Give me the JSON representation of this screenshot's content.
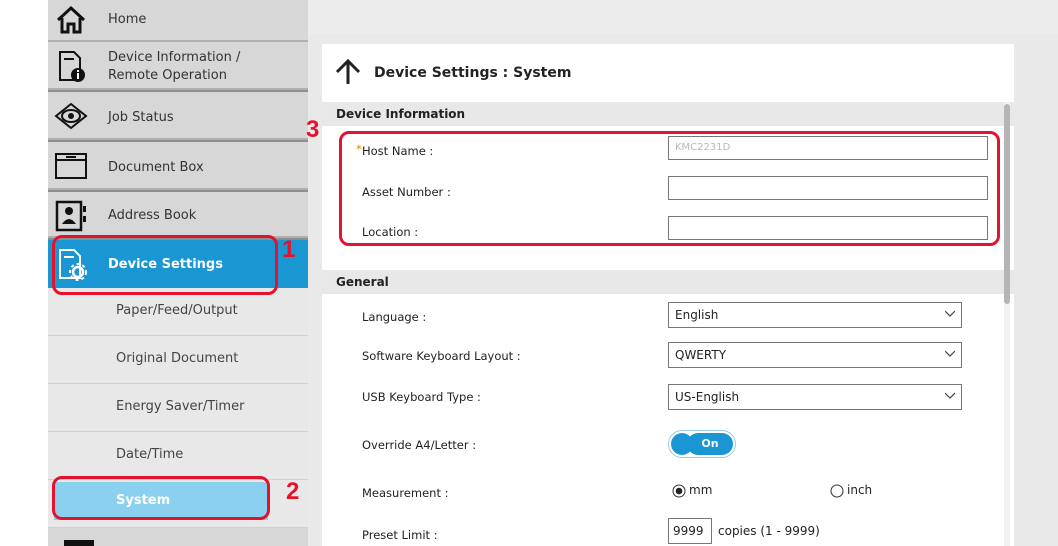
{
  "sidebar": {
    "items": [
      {
        "label": "Home",
        "icon": "home-icon"
      },
      {
        "label": "Device Information /",
        "label2": "Remote Operation",
        "icon": "device-info-icon"
      },
      {
        "label": "Job Status",
        "icon": "eye-icon"
      },
      {
        "label": "Document Box",
        "icon": "folder-icon"
      },
      {
        "label": "Address Book",
        "icon": "address-book-icon"
      },
      {
        "label": "Device Settings",
        "icon": "device-settings-icon"
      }
    ],
    "sub_items": [
      {
        "label": "Paper/Feed/Output"
      },
      {
        "label": "Original Document"
      },
      {
        "label": "Energy Saver/Timer"
      },
      {
        "label": "Date/Time"
      },
      {
        "label": "System"
      }
    ]
  },
  "page": {
    "title": "Device Settings : System",
    "back_icon": "up-arrow-icon"
  },
  "device_information": {
    "heading": "Device Information",
    "host_name_required": "*",
    "host_name_label": "Host Name :",
    "host_name_value": "KMC2231D",
    "asset_number_label": "Asset Number :",
    "asset_number_value": "",
    "location_label": "Location :",
    "location_value": ""
  },
  "general": {
    "heading": "General",
    "language_label": "Language :",
    "language_value": "English",
    "keyboard_layout_label": "Software Keyboard Layout :",
    "keyboard_layout_value": "QWERTY",
    "usb_keyboard_label": "USB Keyboard Type :",
    "usb_keyboard_value": "US-English",
    "override_label": "Override A4/Letter :",
    "override_value": "On",
    "measurement_label": "Measurement :",
    "measurement_options": [
      "mm",
      "inch"
    ],
    "measurement_selected": "mm",
    "preset_limit_label": "Preset Limit :",
    "preset_limit_value": "9999",
    "preset_limit_suffix": "copies (1 - 9999)"
  },
  "callouts": [
    "1",
    "2",
    "3"
  ],
  "colors": {
    "accent": "#1a96d3",
    "highlight_sub": "#8cd0ef",
    "annotation_red": "#e4122d",
    "sidebar_bg": "#d7d7d7"
  }
}
